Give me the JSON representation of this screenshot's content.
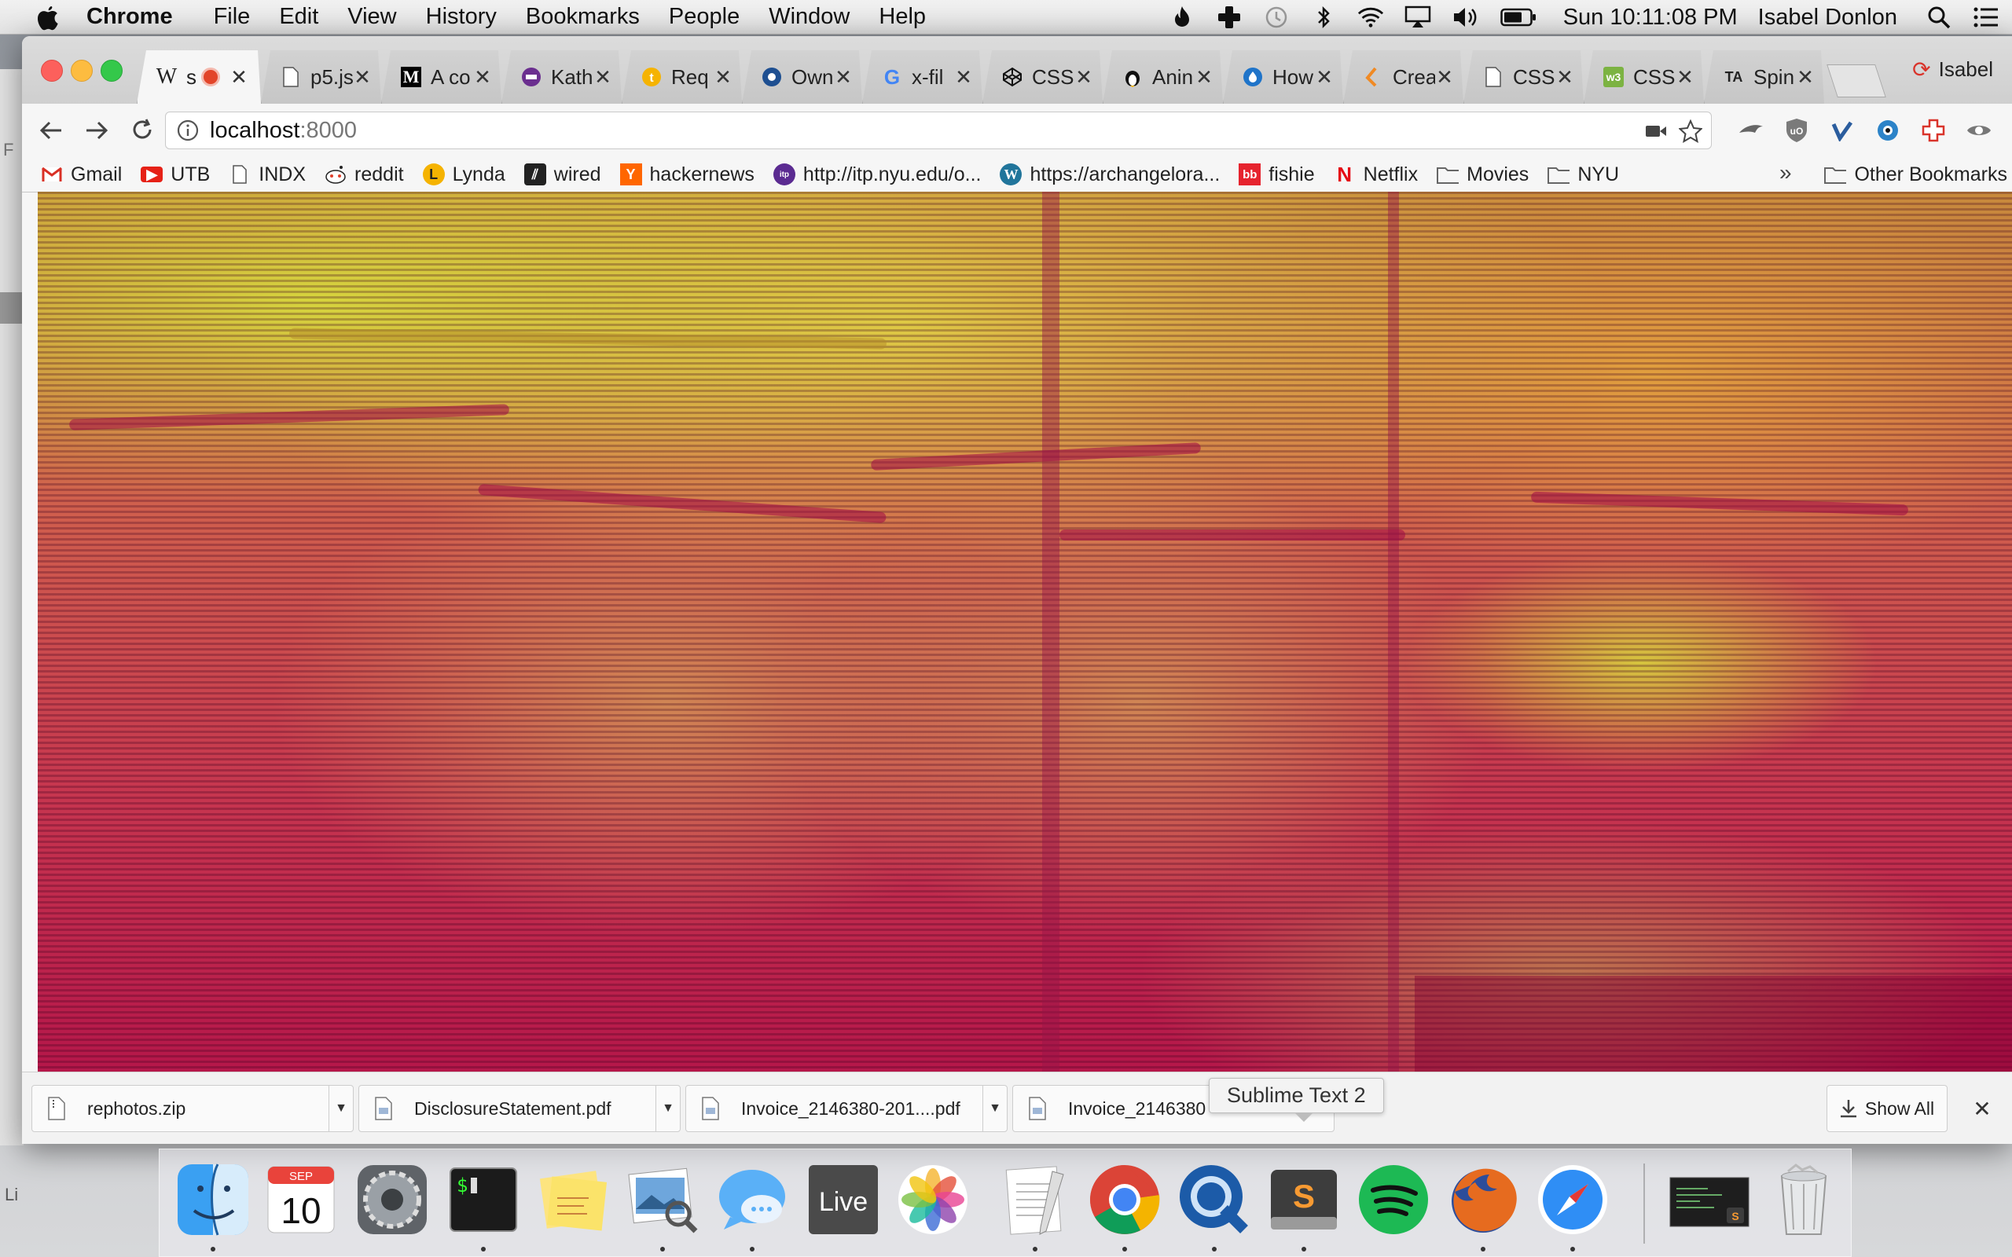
{
  "menubar": {
    "app_name": "Chrome",
    "menus": [
      "File",
      "Edit",
      "View",
      "History",
      "Bookmarks",
      "People",
      "Window",
      "Help"
    ],
    "clock": "Sun 10:11:08 PM",
    "user": "Isabel Donlon",
    "status_icons": [
      "flame-icon",
      "plus-icon",
      "time-machine-icon",
      "bluetooth-icon",
      "wifi-icon",
      "airplay-icon",
      "volume-icon",
      "battery-icon"
    ]
  },
  "browser": {
    "tabs": [
      {
        "title": "W",
        "icon": "wikipedia-icon",
        "active": true
      },
      {
        "title": "p5.js",
        "icon": "page-icon"
      },
      {
        "title": "A co",
        "icon": "medium-icon"
      },
      {
        "title": "Kath",
        "icon": "purple-circle-icon"
      },
      {
        "title": "Req",
        "icon": "yellow-t-icon"
      },
      {
        "title": "Own",
        "icon": "blue-circle-icon"
      },
      {
        "title": "x-fil",
        "icon": "google-icon"
      },
      {
        "title": "CSS",
        "icon": "codepen-icon"
      },
      {
        "title": "Anin",
        "icon": "penguin-icon"
      },
      {
        "title": "How",
        "icon": "drop-icon"
      },
      {
        "title": "Crea",
        "icon": "orange-arrow-icon"
      },
      {
        "title": "CSS",
        "icon": "page-icon"
      },
      {
        "title": "CSS",
        "icon": "css3-icon"
      },
      {
        "title": "Spin",
        "icon": "ta-icon"
      }
    ],
    "profile_name": "Isabel",
    "address": {
      "host": "localhost",
      "port": ":8000"
    },
    "bookmarks": [
      {
        "label": "Gmail",
        "icon": "gmail-icon",
        "color": "#d93025"
      },
      {
        "label": "UTB",
        "icon": "youtube-icon",
        "color": "#e62117"
      },
      {
        "label": "INDX",
        "icon": "page-icon",
        "color": "#ffffff"
      },
      {
        "label": "reddit",
        "icon": "reddit-icon",
        "color": "#ffffff"
      },
      {
        "label": "Lynda",
        "icon": "lynda-icon",
        "color": "#222222"
      },
      {
        "label": "wired",
        "icon": "wired-icon",
        "color": "#222222"
      },
      {
        "label": "hackernews",
        "icon": "hackernews-icon",
        "color": "#ff6600"
      },
      {
        "label": "http://itp.nyu.edu/o...",
        "icon": "itp-icon",
        "color": "#5b2b91"
      },
      {
        "label": "https://archangelora...",
        "icon": "wordpress-icon",
        "color": "#21759b"
      },
      {
        "label": "fishie",
        "icon": "bb-icon",
        "color": "#e6232e"
      },
      {
        "label": "Netflix",
        "icon": "netflix-icon",
        "color": "#e50914"
      },
      {
        "label": "Movies",
        "icon": "folder-icon",
        "color": "#888888"
      },
      {
        "label": "NYU",
        "icon": "folder-icon",
        "color": "#888888"
      }
    ],
    "bookmarks_more": "»",
    "other_bookmarks": "Other Bookmarks",
    "downloads": [
      {
        "name": "rephotos.zip",
        "icon": "zip-file-icon"
      },
      {
        "name": "DisclosureStatement.pdf",
        "icon": "pdf-file-icon"
      },
      {
        "name": "Invoice_2146380-201....pdf",
        "icon": "pdf-file-icon"
      },
      {
        "name": "Invoice_2146380",
        "icon": "pdf-file-icon"
      }
    ],
    "show_all": "Show All",
    "shelf_close": "✕",
    "tooltip": "Sublime Text 2"
  },
  "background_window": {
    "label_top": "F",
    "label_bottom": "Li"
  },
  "dock": {
    "calendar": {
      "month": "SEP",
      "day": "10"
    },
    "terminal_prompt": "$",
    "live_label": "Live",
    "apps": [
      "finder-icon",
      "calendar-icon",
      "system-preferences-icon",
      "terminal-icon",
      "stickies-icon",
      "preview-icon",
      "messages-icon",
      "ableton-live-icon",
      "photos-icon",
      "textedit-icon",
      "chrome-icon",
      "quicktime-icon",
      "sublime-text-icon",
      "spotify-icon",
      "firefox-icon",
      "safari-icon",
      "minimized-window-icon",
      "trash-icon"
    ]
  },
  "colors": {
    "accent": "#4285f4",
    "close": "#fc605c",
    "minimize": "#fdbc40",
    "maximize": "#34c84a"
  }
}
